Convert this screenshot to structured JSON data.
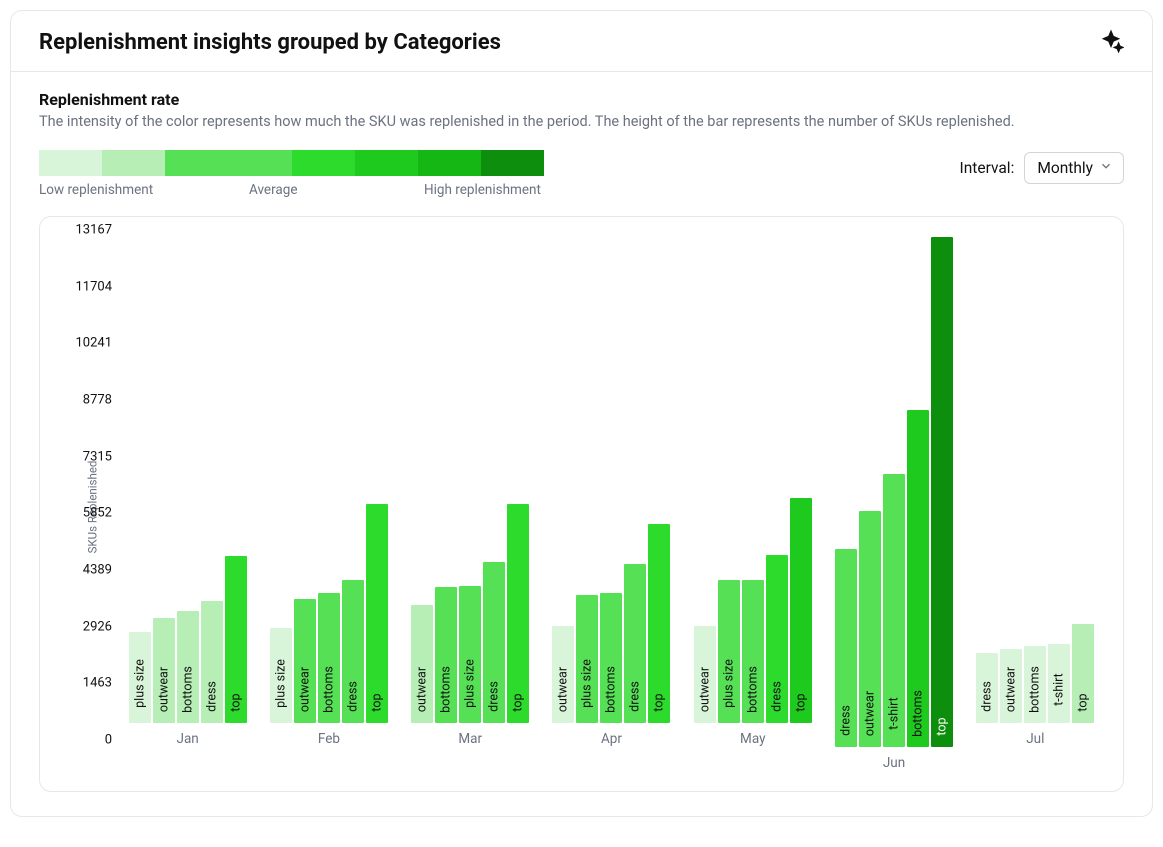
{
  "header": {
    "title": "Replenishment insights grouped by Categories"
  },
  "section": {
    "subtitle": "Replenishment rate",
    "description": "The intensity of the color represents how much the SKU was replenished in the period. The height of the bar represents the number of SKUs replenished."
  },
  "legend": {
    "low": "Low replenishment",
    "avg": "Average",
    "high": "High replenishment",
    "colors": [
      "#d9f5d9",
      "#b6eeb6",
      "#55e055",
      "#55e055",
      "#2ddb2d",
      "#1fca1f",
      "#14b714",
      "#0d8f0d"
    ]
  },
  "interval": {
    "label": "Interval:",
    "value": "Monthly"
  },
  "chart_data": {
    "type": "bar",
    "ylabel": "SKUs Replenished",
    "ylim": [
      0,
      13167
    ],
    "yticks": [
      0,
      1463,
      2926,
      4389,
      5852,
      7315,
      8778,
      10241,
      11704,
      13167
    ],
    "intensity_scale": {
      "min": 1,
      "max": 8
    },
    "months": [
      {
        "label": "Jan",
        "bars": [
          {
            "cat": "plus size",
            "value": 2350,
            "intensity": 1
          },
          {
            "cat": "outwear",
            "value": 2700,
            "intensity": 2
          },
          {
            "cat": "bottoms",
            "value": 2900,
            "intensity": 2
          },
          {
            "cat": "dress",
            "value": 3150,
            "intensity": 2
          },
          {
            "cat": "top",
            "value": 4300,
            "intensity": 5
          }
        ]
      },
      {
        "label": "Feb",
        "bars": [
          {
            "cat": "plus size",
            "value": 2450,
            "intensity": 1
          },
          {
            "cat": "outwear",
            "value": 3200,
            "intensity": 4
          },
          {
            "cat": "bottoms",
            "value": 3350,
            "intensity": 4
          },
          {
            "cat": "dress",
            "value": 3700,
            "intensity": 4
          },
          {
            "cat": "top",
            "value": 5650,
            "intensity": 5
          }
        ]
      },
      {
        "label": "Mar",
        "bars": [
          {
            "cat": "outwear",
            "value": 3050,
            "intensity": 2
          },
          {
            "cat": "bottoms",
            "value": 3500,
            "intensity": 4
          },
          {
            "cat": "plus size",
            "value": 3550,
            "intensity": 4
          },
          {
            "cat": "dress",
            "value": 4150,
            "intensity": 4
          },
          {
            "cat": "top",
            "value": 5650,
            "intensity": 5
          }
        ]
      },
      {
        "label": "Apr",
        "bars": [
          {
            "cat": "outwear",
            "value": 2500,
            "intensity": 1
          },
          {
            "cat": "plus size",
            "value": 3300,
            "intensity": 4
          },
          {
            "cat": "bottoms",
            "value": 3350,
            "intensity": 4
          },
          {
            "cat": "dress",
            "value": 4100,
            "intensity": 4
          },
          {
            "cat": "top",
            "value": 5150,
            "intensity": 5
          }
        ]
      },
      {
        "label": "May",
        "bars": [
          {
            "cat": "outwear",
            "value": 2500,
            "intensity": 1
          },
          {
            "cat": "plus size",
            "value": 3700,
            "intensity": 4
          },
          {
            "cat": "bottoms",
            "value": 3700,
            "intensity": 4
          },
          {
            "cat": "dress",
            "value": 4350,
            "intensity": 5
          },
          {
            "cat": "top",
            "value": 5800,
            "intensity": 6
          }
        ]
      },
      {
        "label": "Jun",
        "bars": [
          {
            "cat": "dress",
            "value": 5100,
            "intensity": 4
          },
          {
            "cat": "outwear",
            "value": 6100,
            "intensity": 3
          },
          {
            "cat": "t-shirt",
            "value": 7050,
            "intensity": 3
          },
          {
            "cat": "bottoms",
            "value": 8700,
            "intensity": 6
          },
          {
            "cat": "top",
            "value": 13167,
            "intensity": 8
          }
        ]
      },
      {
        "label": "Jul",
        "bars": [
          {
            "cat": "dress",
            "value": 1820,
            "intensity": 1
          },
          {
            "cat": "outwear",
            "value": 1900,
            "intensity": 1
          },
          {
            "cat": "bottoms",
            "value": 2000,
            "intensity": 1
          },
          {
            "cat": "t-shirt",
            "value": 2050,
            "intensity": 1
          },
          {
            "cat": "top",
            "value": 2550,
            "intensity": 2
          }
        ]
      }
    ]
  }
}
